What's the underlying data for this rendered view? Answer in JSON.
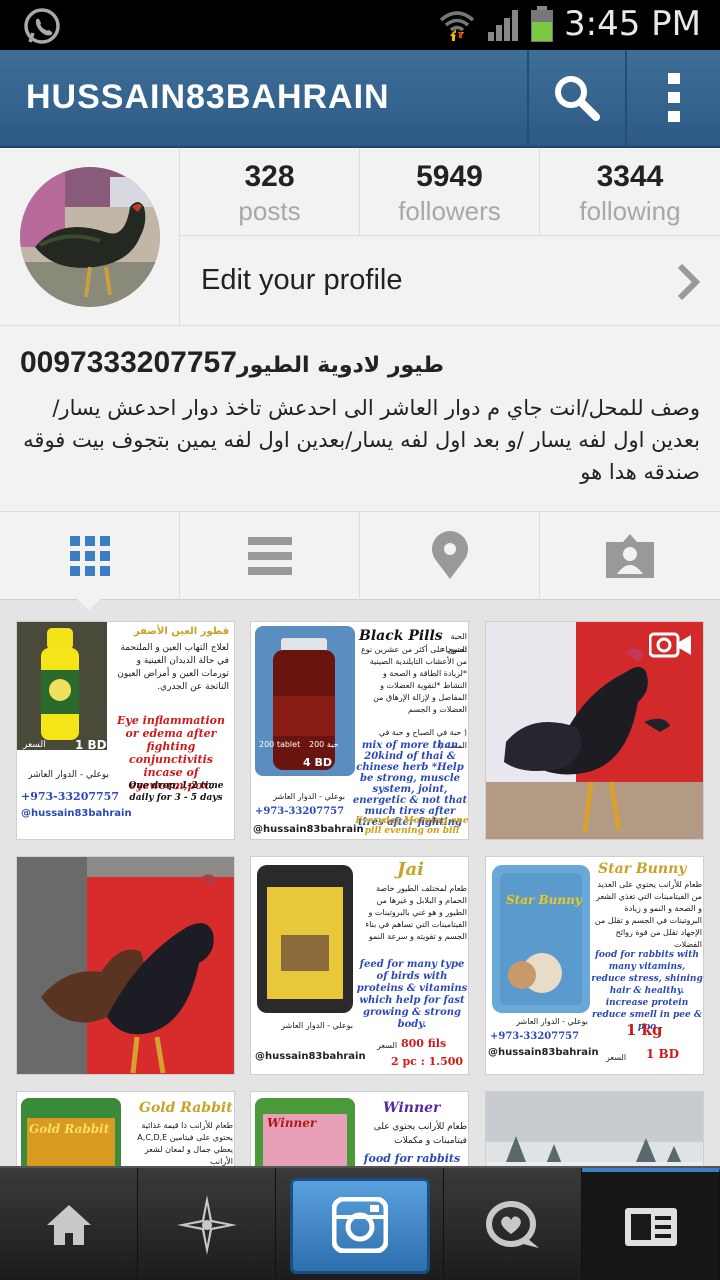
{
  "status_bar": {
    "time": "3:45 PM",
    "icons": [
      "whatsapp-icon",
      "wifi-icon",
      "signal-icon",
      "battery-icon"
    ],
    "battery_color": "#7ac943"
  },
  "app_bar": {
    "username": "HUSSAIN83BAHRAIN",
    "color": "#336694",
    "icons": [
      "search-icon",
      "more-icon"
    ]
  },
  "profile": {
    "stats": [
      {
        "value": "328",
        "label": "posts"
      },
      {
        "value": "5949",
        "label": "followers"
      },
      {
        "value": "3344",
        "label": "following"
      }
    ],
    "edit_label": "Edit your profile",
    "name_ar": "طيور لادوية الطيور",
    "name_number": "0097333207757",
    "bio": "وصف للمحل/انت جاي م دوار العاشر الى احدعش تاخذ دوار احدعش يسار/بعدين اول لفه يسار /و بعد اول لفه يسار/بعدين اول لفه يمين بتجوف بيت فوقه صندقه هدا هو"
  },
  "tabs": [
    "grid-view-icon",
    "list-view-icon",
    "location-icon",
    "tagged-photos-icon"
  ],
  "posts": [
    {
      "kind": "flyer",
      "title_ar": "قطور العين الأصفر",
      "desc_ar": "لعلاج التهاب العين و الملتحمة في حالة الديدان العينية و تورمات العين و أمراض العيون الناتجة عن الجدري.",
      "desc_en": "Eye inflammation or edema after fighting conjunctivitis incase of eyeworm,pox.",
      "dose_en": "One drop, 1-2 time daily for 3 - 5 days",
      "price_label": "1 BD",
      "price_ar": "السعر",
      "location_ar": "بوعلي - الدوار العاشر",
      "phone": "+973-33207757",
      "handle": "@hussain83bahrain"
    },
    {
      "kind": "flyer",
      "title_en": "Black Pills",
      "title_ar": "الحبة السوداء",
      "desc_ar": "تحتوي على أكثر من عشرين نوع من الأعشاب التايلندية الصينية *لزيادة الطاقة و الصحة و النشاط *لتقوية العضلات و المفاصل و لإزالة الإرهاق من العضلات و الجسم",
      "note_ar": "( حبة في الصباح و حبة في المساء )",
      "desc_en": "mix of more than 20kind of thai & chinese herb *Help be strong, muscle system, joint, energetic & not that much tires after tires after fighting",
      "dose_en": "Everyday Morning one pill evening on bill",
      "jar_label": "200 tablet",
      "jar_label_ar": "200 حبة",
      "price_label": "4 BD",
      "location_ar": "بوعلي - الدوار العاشر",
      "phone": "+973-33207757",
      "handle": "@hussain83bahrain"
    },
    {
      "kind": "photo",
      "subject": "rooster on red wall",
      "video": true
    },
    {
      "kind": "photo",
      "subject": "two roosters on red wall",
      "video": false
    },
    {
      "kind": "flyer",
      "title_en": "Jai",
      "desc_ar": "طعام لمختلف الطيور خاصة الحمام و البلابل و غيرها من الطيور و هو غني بالبروتينات و الفيتامينات التي تساهم في بناء الجسم و تقويته و سرعة النمو",
      "desc_en": "feed for many type of birds with proteins & vitamins which help for fast growing & strong body.",
      "location_ar": "بوعلي - الدوار العاشر",
      "price_label": "800 fils",
      "price_ar": "السعر",
      "price2": "2 pc : 1.500",
      "handle": "@hussain83bahrain"
    },
    {
      "kind": "flyer",
      "title_en": "Star Bunny",
      "bag_label": "Star Bunny",
      "desc_ar": "طعام للأرانب يحتوي على العديد من الفيتامينات التي تغذي الشعر و الصحة و النمو و زيادة البروتينات في الجسم و تقلل من الإجهاد تقلل من قوة روائح الفضلات",
      "desc_en": "food for rabbits with many vitamins, reduce stress, shining hair & healthy. increase protein reduce smell in pee & poo",
      "weight": "1 kg",
      "location_ar": "بوعلي - الدوار العاشر",
      "phone": "+973-33207757",
      "handle": "@hussain83bahrain",
      "price_label": "1 BD",
      "price_ar": "السعر"
    },
    {
      "kind": "flyer",
      "title_en": "Gold Rabbit",
      "bag_label": "Gold Rabbit",
      "desc_ar": "طعام للأرانب ذا قيمة غذائية يحتوي على فيتامين A,C,D,E يعطي جمال و لمعان لشعر الأرانب"
    },
    {
      "kind": "flyer",
      "title_en": "Winner",
      "bag_label": "Winner",
      "desc_ar": "طعام للأرانب يحتوي على فيتامينات و مكملات",
      "desc_en": "food for rabbits"
    },
    {
      "kind": "photo",
      "subject": "winter trees"
    }
  ],
  "bottom_nav": [
    "home-icon",
    "explore-icon",
    "camera-icon",
    "news-icon",
    "profile-icon"
  ],
  "colors": {
    "accent": "#3a7fc4",
    "title_gold": "#c9a227",
    "phone_blue": "#2a48b8",
    "price_red": "#d01818"
  }
}
